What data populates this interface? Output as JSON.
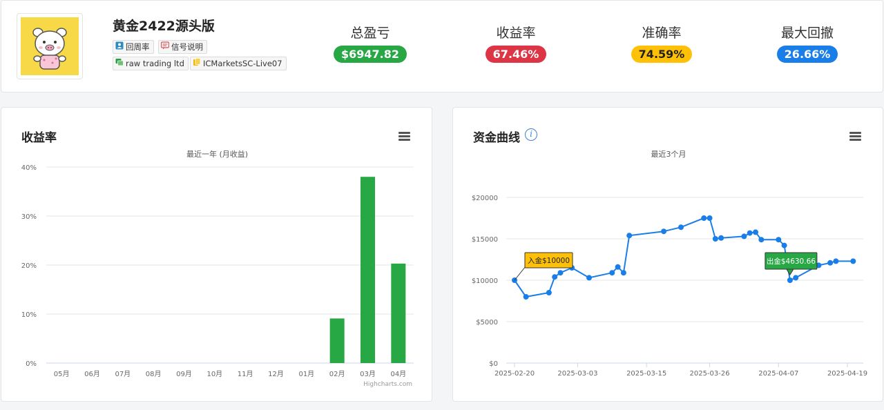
{
  "header": {
    "signal_name": "黄金2422源头版",
    "tags": {
      "turnover": "回周率",
      "signal_desc": "信号说明",
      "broker": "raw trading ltd",
      "server": "ICMarketsSC-Live07"
    },
    "stats": [
      {
        "label": "总盈亏",
        "value": "$6947.82",
        "color": "#28a745"
      },
      {
        "label": "收益率",
        "value": "67.46%",
        "color": "#dc3545"
      },
      {
        "label": "准确率",
        "value": "74.59%",
        "color": "#ffc107"
      },
      {
        "label": "最大回撤",
        "value": "26.66%",
        "color": "#1a7ee8"
      }
    ]
  },
  "returns_panel": {
    "title": "收益率",
    "subtitle": "最近一年 (月收益)",
    "credit": "Highcharts.com"
  },
  "equity_panel": {
    "title": "资金曲线",
    "subtitle": "最近3个月"
  },
  "chart_data": [
    {
      "type": "bar",
      "title": "收益率",
      "subtitle": "最近一年 (月收益)",
      "categories": [
        "05月",
        "06月",
        "07月",
        "08月",
        "09月",
        "10月",
        "11月",
        "12月",
        "01月",
        "02月",
        "03月",
        "04月"
      ],
      "values": [
        0,
        0,
        0,
        0,
        0,
        0,
        0,
        0,
        0,
        9.1,
        38.0,
        20.3
      ],
      "ylim": [
        0,
        40
      ],
      "yticks": [
        "0%",
        "10%",
        "20%",
        "30%",
        "40%"
      ],
      "grid": true,
      "color": "#28a745"
    },
    {
      "type": "line",
      "title": "资金曲线",
      "subtitle": "最近3个月",
      "ylim": [
        0,
        20000
      ],
      "yticks": [
        "$0",
        "$5000",
        "$10000",
        "$15000",
        "$20000"
      ],
      "xticks": [
        "2025-02-20",
        "2025-03-03",
        "2025-03-15",
        "2025-03-26",
        "2025-04-07",
        "2025-04-19"
      ],
      "grid": true,
      "color": "#1a7ee8",
      "series": [
        {
          "points": [
            {
              "x": "2025-02-20",
              "y": 10000
            },
            {
              "x": "2025-02-22",
              "y": 8000
            },
            {
              "x": "2025-02-26",
              "y": 8500
            },
            {
              "x": "2025-02-27",
              "y": 10400
            },
            {
              "x": "2025-02-28",
              "y": 10900
            },
            {
              "x": "2025-03-02",
              "y": 11500
            },
            {
              "x": "2025-03-05",
              "y": 10300
            },
            {
              "x": "2025-03-09",
              "y": 10900
            },
            {
              "x": "2025-03-10",
              "y": 11600
            },
            {
              "x": "2025-03-11",
              "y": 10900
            },
            {
              "x": "2025-03-12",
              "y": 15400
            },
            {
              "x": "2025-03-18",
              "y": 15900
            },
            {
              "x": "2025-03-21",
              "y": 16400
            },
            {
              "x": "2025-03-25",
              "y": 17500
            },
            {
              "x": "2025-03-26",
              "y": 17500
            },
            {
              "x": "2025-03-27",
              "y": 15000
            },
            {
              "x": "2025-03-28",
              "y": 15100
            },
            {
              "x": "2025-04-01",
              "y": 15300
            },
            {
              "x": "2025-04-02",
              "y": 15700
            },
            {
              "x": "2025-04-03",
              "y": 15800
            },
            {
              "x": "2025-04-04",
              "y": 14900
            },
            {
              "x": "2025-04-07",
              "y": 14900
            },
            {
              "x": "2025-04-08",
              "y": 14200
            },
            {
              "x": "2025-04-09",
              "y": 10000
            },
            {
              "x": "2025-04-10",
              "y": 10300
            },
            {
              "x": "2025-04-14",
              "y": 11800
            },
            {
              "x": "2025-04-16",
              "y": 12100
            },
            {
              "x": "2025-04-17",
              "y": 12300
            },
            {
              "x": "2025-04-20",
              "y": 12300
            }
          ]
        }
      ],
      "annotations": [
        {
          "text": "入金$10000",
          "x": "2025-02-20",
          "y": 10000,
          "color": "#ffc107"
        },
        {
          "text": "出金$4630.66",
          "x": "2025-04-09",
          "y": 10000,
          "color": "#28a745"
        }
      ]
    }
  ]
}
